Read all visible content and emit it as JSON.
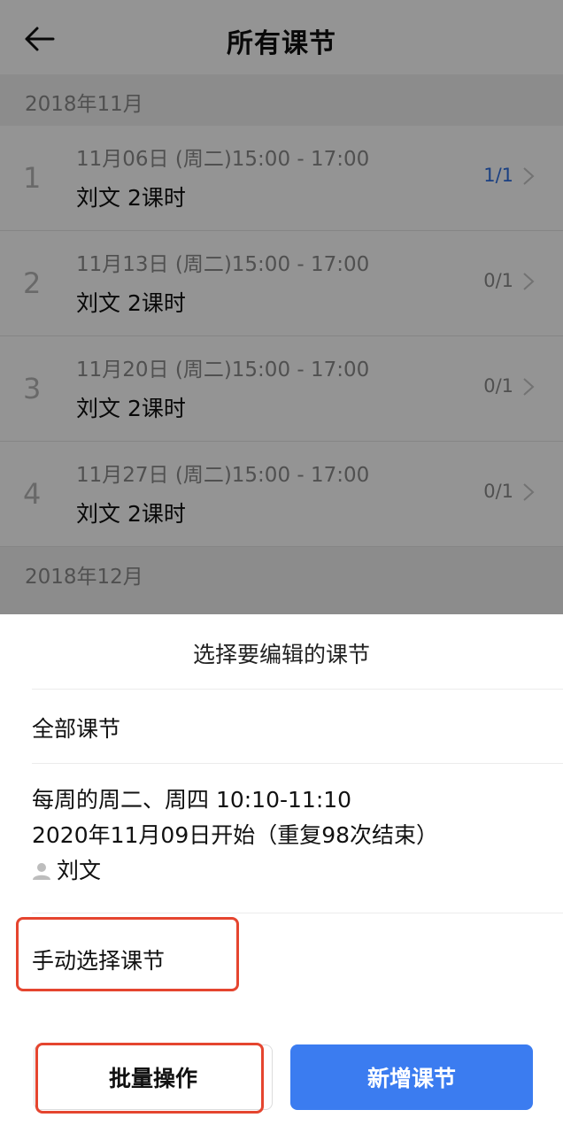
{
  "nav": {
    "title": "所有课节",
    "back_icon": "arrow-left-icon"
  },
  "months": [
    {
      "label": "2018年11月"
    },
    {
      "label": "2018年12月"
    }
  ],
  "lessons": [
    {
      "index": "1",
      "time": "11月06日 (周二)15:00 - 17:00",
      "teacher": "刘文  2课时",
      "count": "1/1"
    },
    {
      "index": "2",
      "time": "11月13日 (周二)15:00 - 17:00",
      "teacher": "刘文  2课时",
      "count": "0/1"
    },
    {
      "index": "3",
      "time": "11月20日 (周二)15:00 - 17:00",
      "teacher": "刘文  2课时",
      "count": "0/1"
    },
    {
      "index": "4",
      "time": "11月27日 (周二)15:00 - 17:00",
      "teacher": "刘文  2课时",
      "count": "0/1"
    }
  ],
  "sheet": {
    "title": "选择要编辑的课节",
    "all_lessons": "全部课节",
    "rule": {
      "line1": "每周的周二、周四 10:10-11:10",
      "line2": "2020年11月09日开始（重复98次结束）",
      "teacher": "刘文",
      "person_icon": "person-icon"
    },
    "manual_select": "手动选择课节"
  },
  "buttons": {
    "batch": "批量操作",
    "add": "新增课节"
  },
  "colors": {
    "accent": "#3b7cf0",
    "highlight": "#e5452f",
    "active_count": "#2f6fe0"
  }
}
